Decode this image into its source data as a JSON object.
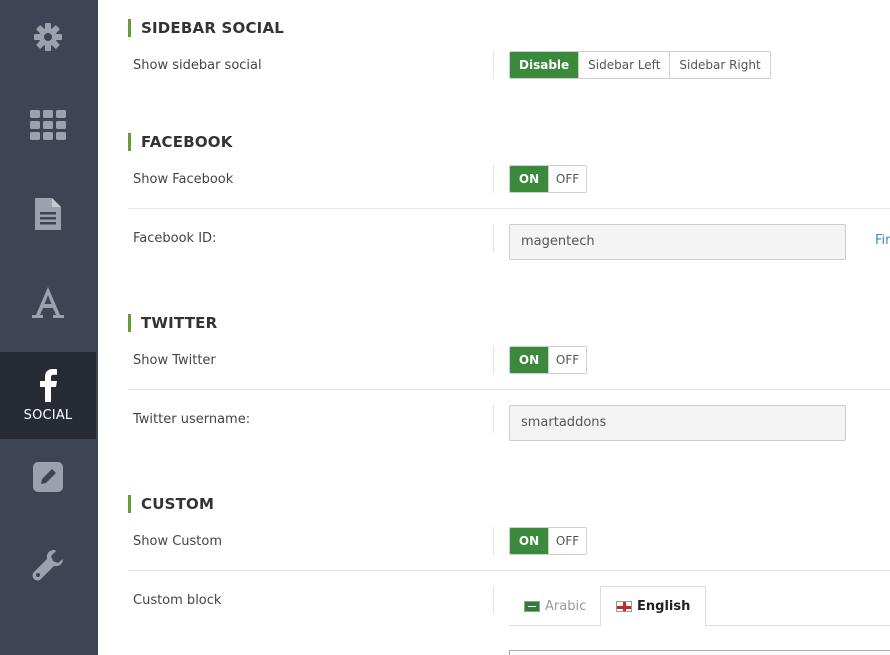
{
  "sidebar": {
    "items": [
      {
        "icon": "gear-icon",
        "label": ""
      },
      {
        "icon": "grid-icon",
        "label": ""
      },
      {
        "icon": "document-icon",
        "label": ""
      },
      {
        "icon": "font-icon",
        "label": ""
      },
      {
        "icon": "facebook-icon",
        "label": "SOCIAL",
        "active": true
      },
      {
        "icon": "edit-icon",
        "label": ""
      },
      {
        "icon": "wrench-icon",
        "label": ""
      }
    ]
  },
  "sections": {
    "sidebar_social": {
      "title": "SIDEBAR SOCIAL",
      "show_label": "Show sidebar social",
      "options": [
        "Disable",
        "Sidebar Left",
        "Sidebar Right"
      ],
      "selected": "Disable"
    },
    "facebook": {
      "title": "FACEBOOK",
      "show_label": "Show Facebook",
      "toggle_on": "ON",
      "toggle_off": "OFF",
      "id_label": "Facebook ID:",
      "id_value": "magentech",
      "help_link": "Fir"
    },
    "twitter": {
      "title": "TWITTER",
      "show_label": "Show Twitter",
      "toggle_on": "ON",
      "toggle_off": "OFF",
      "username_label": "Twitter username:",
      "username_value": "smartaddons"
    },
    "custom": {
      "title": "CUSTOM",
      "show_label": "Show Custom",
      "toggle_on": "ON",
      "toggle_off": "OFF",
      "block_label": "Custom block",
      "languages": [
        "Arabic",
        "English"
      ],
      "active_language": "English"
    }
  },
  "colors": {
    "sidebar_bg": "#3d4453",
    "sidebar_active": "#262b35",
    "accent_green": "#3b8a3b",
    "section_bar": "#6a9a3a",
    "link": "#3a89c9"
  }
}
